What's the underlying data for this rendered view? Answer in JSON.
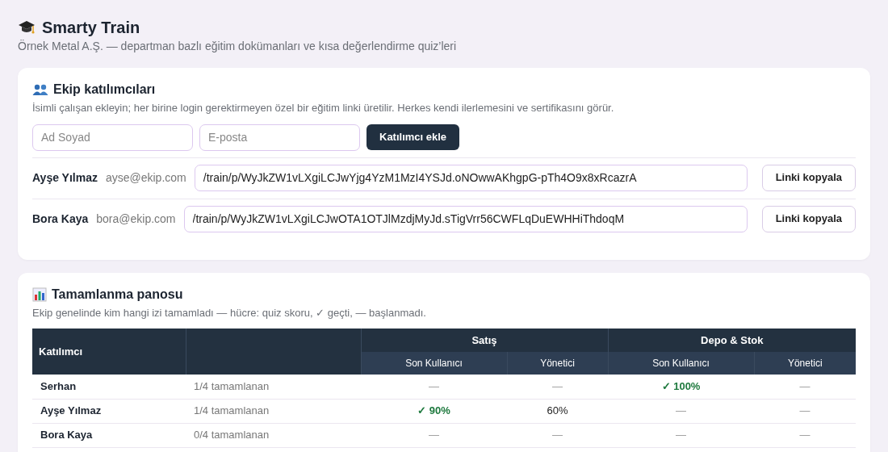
{
  "app": {
    "title": "Smarty Train",
    "subtitle": "Örnek Metal A.Ş. — departman bazlı eğitim dokümanları ve kısa değerlendirme quiz’leri"
  },
  "team": {
    "title": "Ekip katılımcıları",
    "description": "İsimli çalışan ekleyin; her birine login gerektirmeyen özel bir eğitim linki üretilir. Herkes kendi ilerlemesini ve sertifikasını görür.",
    "name_field": {
      "placeholder": "Ad Soyad"
    },
    "email_field": {
      "placeholder": "E-posta"
    },
    "add_button": "Katılımcı ekle",
    "participants": [
      {
        "name": "Ayşe Yılmaz",
        "email": "ayse@ekip.com",
        "link": "/train/p/WyJkZW1vLXgiLCJwYjg4YzM1MzI4YSJd.oNOwwAKhgpG-pTh4O9x8xRcazrA",
        "copy_button": "Linki kopyala"
      },
      {
        "name": "Bora Kaya",
        "email": "bora@ekip.com",
        "link": "/train/p/WyJkZW1vLXgiLCJwOTA1OTJlMzdjMyJd.sTigVrr56CWFLqDuEWHHiThdoqM",
        "copy_button": "Linki kopyala"
      }
    ]
  },
  "board": {
    "title": "Tamamlanma panosu",
    "description": "Ekip genelinde kim hangi izi tamamladı — hücre: quiz skoru, ✓ geçti, — başlanmadı.",
    "table": {
      "participant_header": "Katılımcı",
      "groups": [
        {
          "label": "Satış",
          "columns": [
            "Son Kullanıcı",
            "Yönetici"
          ]
        },
        {
          "label": "Depo & Stok",
          "columns": [
            "Son Kullanıcı",
            "Yönetici"
          ]
        }
      ],
      "rows": [
        {
          "name": "Serhan",
          "progress": "1/4 tamamlanan",
          "cells": [
            {
              "kind": "none",
              "text": "—"
            },
            {
              "kind": "none",
              "text": "—"
            },
            {
              "kind": "passed",
              "text": "✓ 100%"
            },
            {
              "kind": "none",
              "text": "—"
            }
          ]
        },
        {
          "name": "Ayşe Yılmaz",
          "progress": "1/4 tamamlanan",
          "cells": [
            {
              "kind": "passed",
              "text": "✓ 90%"
            },
            {
              "kind": "score",
              "text": "60%"
            },
            {
              "kind": "none",
              "text": "—"
            },
            {
              "kind": "none",
              "text": "—"
            }
          ]
        },
        {
          "name": "Bora Kaya",
          "progress": "0/4 tamamlanan",
          "cells": [
            {
              "kind": "none",
              "text": "—"
            },
            {
              "kind": "none",
              "text": "—"
            },
            {
              "kind": "none",
              "text": "—"
            },
            {
              "kind": "none",
              "text": "—"
            }
          ]
        }
      ]
    }
  }
}
